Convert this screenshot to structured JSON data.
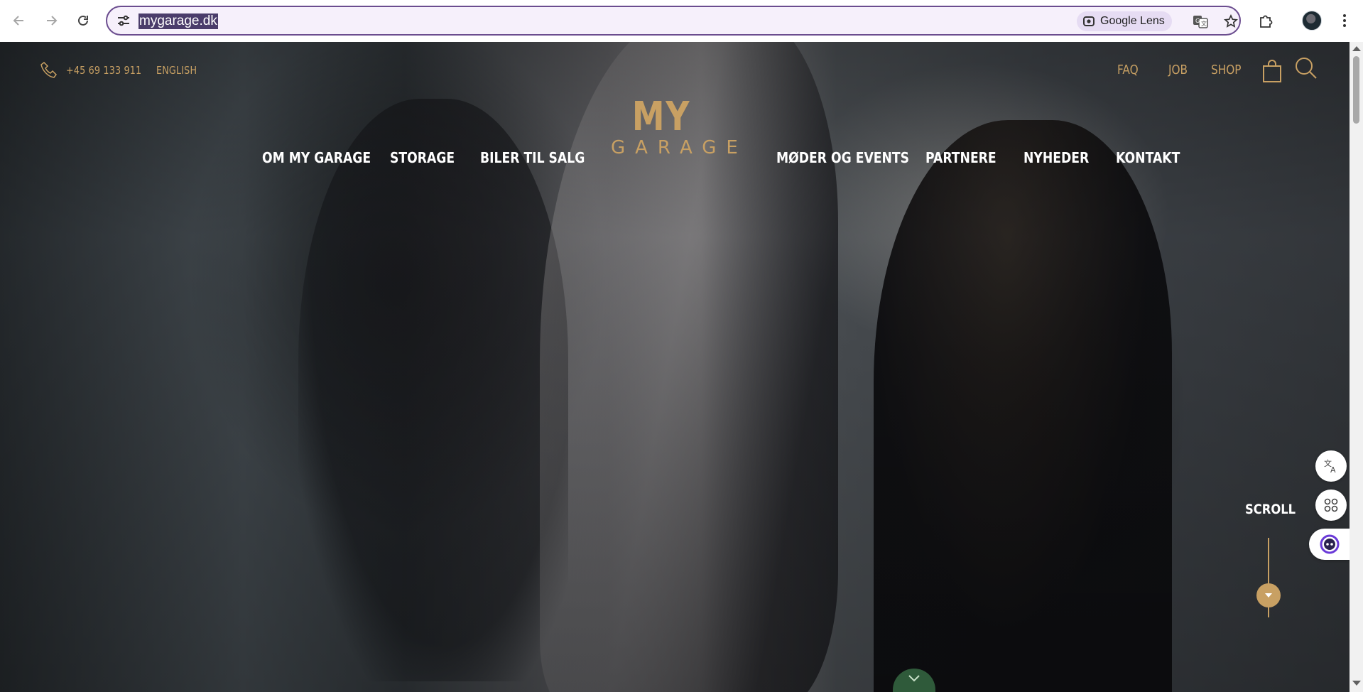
{
  "browser": {
    "url": "mygarage.dk",
    "lens_label": "Google Lens"
  },
  "site": {
    "phone": "+45 69 133 911",
    "language_link": "ENGLISH",
    "utility_links": [
      "FAQ",
      "JOB",
      "SHOP"
    ],
    "logo": {
      "line1": "MY",
      "line2": "GARAGE"
    },
    "nav_left": [
      "OM MY GARAGE",
      "STORAGE",
      "BILER TIL SALG"
    ],
    "nav_right": [
      "MØDER OG EVENTS",
      "PARTNERE",
      "NYHEDER",
      "KONTAKT"
    ],
    "scroll_label": "SCROLL"
  },
  "colors": {
    "gold": "#c8a063",
    "omnibox_border": "#6b4d8f",
    "url_highlight": "#4b3d6b",
    "lens_chip": "#e6dcf3",
    "bottom_tab": "#2f5a3a"
  },
  "icons": {
    "site_info": "tune-icon",
    "lens": "google-lens-icon",
    "translate": "translate-icon",
    "bookmark": "star-icon",
    "extensions": "puzzle-icon",
    "menu": "kebab-menu-icon",
    "phone": "phone-icon",
    "cart": "shopping-bag-icon",
    "search": "search-icon"
  }
}
